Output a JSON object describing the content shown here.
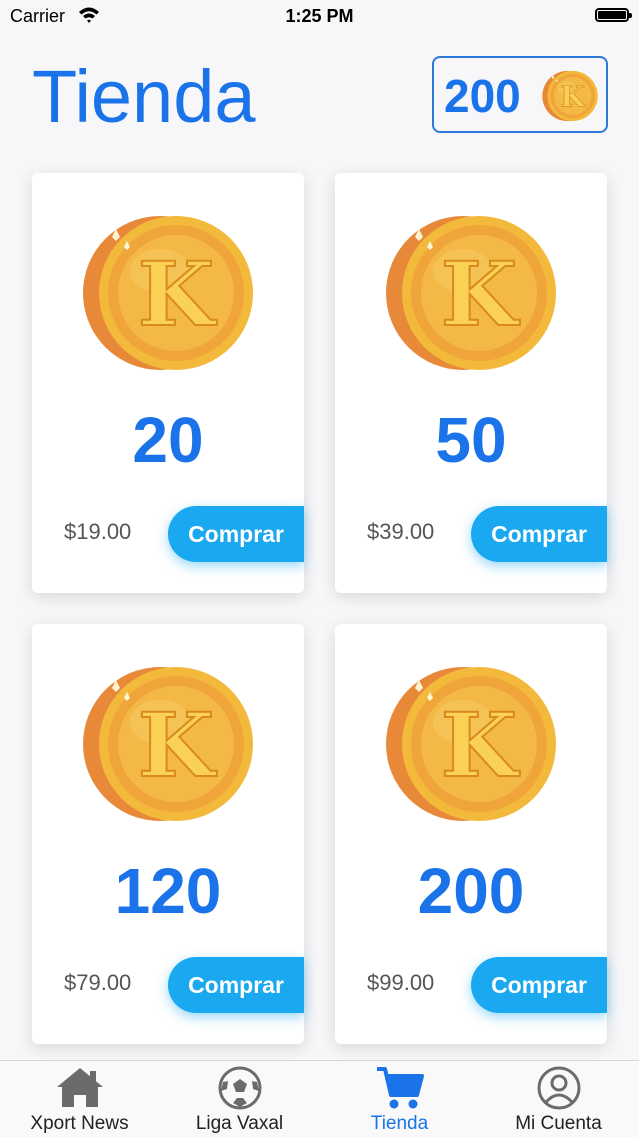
{
  "status_bar": {
    "carrier": "Carrier",
    "time": "1:25 PM"
  },
  "header": {
    "title": "Tienda",
    "balance": "200"
  },
  "coin_letter": "K",
  "products": [
    {
      "amount": "20",
      "price": "$19.00",
      "buy_label": "Comprar"
    },
    {
      "amount": "50",
      "price": "$39.00",
      "buy_label": "Comprar"
    },
    {
      "amount": "120",
      "price": "$79.00",
      "buy_label": "Comprar"
    },
    {
      "amount": "200",
      "price": "$99.00",
      "buy_label": "Comprar"
    }
  ],
  "tabs": [
    {
      "label": "Xport News",
      "icon": "home-icon"
    },
    {
      "label": "Liga Vaxal",
      "icon": "soccer-ball-icon"
    },
    {
      "label": "Tienda",
      "icon": "cart-icon",
      "active": true
    },
    {
      "label": "Mi Cuenta",
      "icon": "user-circle-icon"
    }
  ],
  "colors": {
    "accent": "#1a73e8",
    "button": "#1aa8f0",
    "coin": "#f2a93b"
  }
}
